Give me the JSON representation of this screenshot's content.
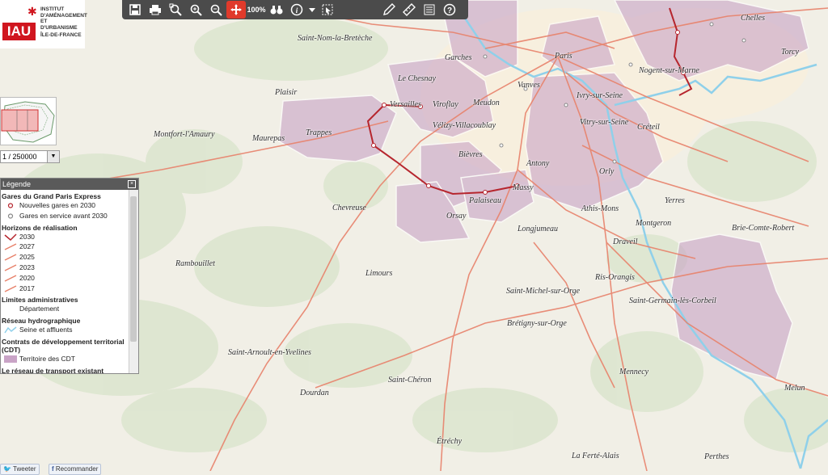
{
  "logo": {
    "acronym": "IAU",
    "line1": "INSTITUT",
    "line2": "D'AMÉNAGEMENT",
    "line3": "ET D'URBANISME",
    "region": "ÎLE-DE-FRANCE",
    "brand_color": "#d0161f"
  },
  "toolbar": {
    "zoom100_label": "100%",
    "tools": [
      "save-icon",
      "print-icon",
      "zoom-box-icon",
      "zoom-in-icon",
      "zoom-out-icon",
      "pan-icon",
      "zoom-100-icon",
      "binoculars-icon",
      "info-icon",
      "dropdown-arrow-icon",
      "select-icon",
      "draw-pencil-icon",
      "measure-ruler-icon",
      "list-icon",
      "help-icon"
    ]
  },
  "scale": {
    "value": "1 / 250000"
  },
  "legend": {
    "title": "Légende",
    "sections": {
      "gares": {
        "title": "Gares du Grand Paris Express",
        "items": [
          "Nouvelles gares en 2030",
          "Gares en service avant 2030"
        ]
      },
      "horizons": {
        "title": "Horizons de réalisation",
        "items": [
          "2030",
          "2027",
          "2025",
          "2023",
          "2020",
          "2017"
        ]
      },
      "limites": {
        "title": "Limites administratives",
        "items": [
          "Département"
        ]
      },
      "hydro": {
        "title": "Réseau hydrographique",
        "items": [
          "Seine et affluents"
        ]
      },
      "cdt": {
        "title": "Contrats de développement territorial (CDT)",
        "items": [
          "Territoire des CDT"
        ]
      },
      "transport": {
        "title": "Le réseau de transport existant"
      }
    }
  },
  "places": [
    "Saint-Nom-la-Bretèche",
    "Garches",
    "Paris",
    "Chelles",
    "Torcy",
    "Le Chesnay",
    "Nogent-sur-Marne",
    "Plaisir",
    "Versailles",
    "Viroflay",
    "Meudon",
    "Vanves",
    "Ivry-sur-Seine",
    "Vitry-sur-Seine",
    "Créteil",
    "Trappes",
    "Maurepas",
    "Vélizy-Villacoublay",
    "Montfort-l'Amaury",
    "Bièvres",
    "Antony",
    "Orly",
    "Massy",
    "Palaiseau",
    "Chevreuse",
    "Orsay",
    "Athis-Mons",
    "Yerres",
    "Longjumeau",
    "Montgeron",
    "Brie-Comte-Robert",
    "Draveil",
    "Rambouillet",
    "Limours",
    "Ris-Orangis",
    "Saint-Michel-sur-Orge",
    "Saint-Germain-lès-Corbeil",
    "Brétigny-sur-Orge",
    "Saint-Arnoult-en-Yvelines",
    "Saint-Chéron",
    "Dourdan",
    "Mennecy",
    "Melun",
    "Étréchy",
    "La Ferté-Alais",
    "Perthes"
  ],
  "social": {
    "tweet": "Tweeter",
    "recommend": "Recommander"
  },
  "colors": {
    "cdt_fill": "#c9a3c6",
    "road": "#e8826b",
    "gpe_line": "#b6262e",
    "water": "#8fd0ea",
    "forest": "#dfe8d2",
    "urban": "#f6ecd8"
  }
}
